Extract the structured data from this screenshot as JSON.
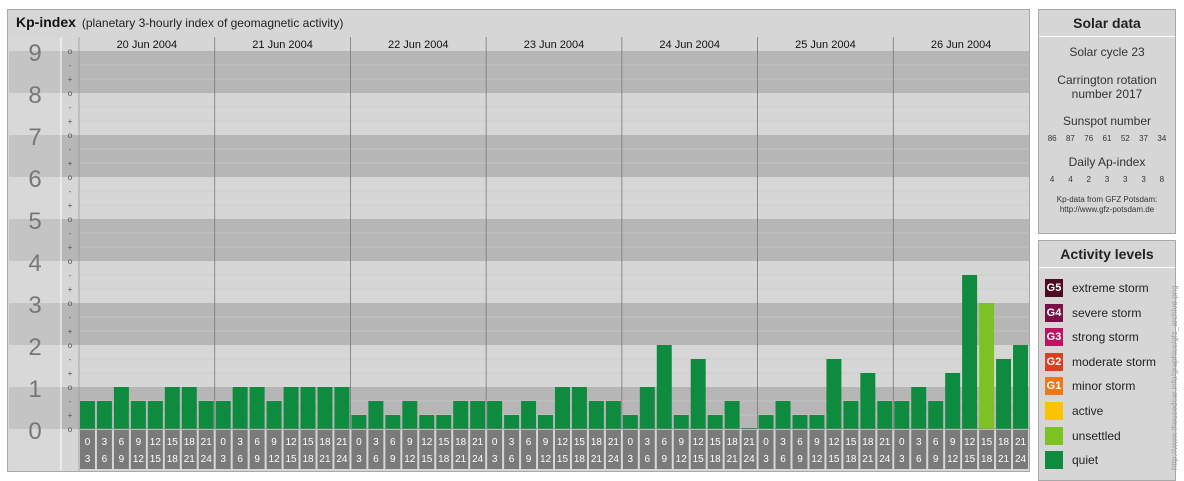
{
  "title": {
    "main": "Kp-index",
    "subtitle": "(planetary 3-hourly index of geomagnetic activity)"
  },
  "chart_data": {
    "type": "bar",
    "title": "Kp-index",
    "subtitle": "(planetary 3-hourly index of geomagnetic activity)",
    "ylim": [
      0,
      9
    ],
    "y_major_labels": [
      "0",
      "1",
      "2",
      "3",
      "4",
      "5",
      "6",
      "7",
      "8",
      "9"
    ],
    "y_minor_labels": [
      "o",
      "+",
      "-"
    ],
    "days": [
      "20 Jun 2004",
      "21 Jun 2004",
      "22 Jun 2004",
      "23 Jun 2004",
      "24 Jun 2004",
      "25 Jun 2004",
      "26 Jun 2004"
    ],
    "interval_start_labels": [
      "0",
      "3",
      "6",
      "9",
      "12",
      "15",
      "18",
      "21"
    ],
    "interval_end_labels": [
      "3",
      "6",
      "9",
      "12",
      "15",
      "18",
      "21",
      "24"
    ],
    "values": [
      [
        0.667,
        0.667,
        1.0,
        0.667,
        0.667,
        1.0,
        1.0,
        0.667
      ],
      [
        0.667,
        1.0,
        1.0,
        0.667,
        1.0,
        1.0,
        1.0,
        1.0
      ],
      [
        0.333,
        0.667,
        0.333,
        0.667,
        0.333,
        0.333,
        0.667,
        0.667
      ],
      [
        0.667,
        0.333,
        0.667,
        0.333,
        1.0,
        1.0,
        0.667,
        0.667
      ],
      [
        0.333,
        1.0,
        2.0,
        0.333,
        1.667,
        0.333,
        0.667,
        0.0
      ],
      [
        0.333,
        0.667,
        0.333,
        0.333,
        1.667,
        0.667,
        1.333,
        0.667
      ],
      [
        0.667,
        1.0,
        0.667,
        1.333,
        3.667,
        3.0,
        1.667,
        2.0
      ]
    ],
    "color_rules": [
      {
        "min": 0,
        "max": 2.5,
        "level": "quiet"
      },
      {
        "min": 3.0,
        "max": 3.5,
        "level": "unsettled"
      },
      {
        "min": 4.0,
        "max": 4.5,
        "level": "active"
      }
    ],
    "grid": true,
    "legend": "right"
  },
  "colors": {
    "quiet": "#0e8b3f",
    "unsettled": "#7dc224",
    "active": "#f9c300",
    "band_dark": "#b6b6b6",
    "band_light": "#d6d6d6",
    "axis_label": "#777777",
    "label_cell": "#7a7a7a"
  },
  "solar": {
    "title": "Solar data",
    "cycle": "Solar cycle 23",
    "carrington_line1": "Carrington rotation",
    "carrington_line2": "number 2017",
    "sunspot_title": "Sunspot number",
    "sunspot_values": [
      "86",
      "87",
      "76",
      "61",
      "52",
      "37",
      "34"
    ],
    "ap_title": "Daily Ap-index",
    "ap_values": [
      "4",
      "4",
      "2",
      "3",
      "3",
      "3",
      "8"
    ],
    "source_line1": "Kp-data from GFZ Potsdam:",
    "source_line2": "http://www.gfz-potsdam.de"
  },
  "activity": {
    "title": "Activity levels",
    "items": [
      {
        "code": "G5",
        "label": "extreme storm",
        "color": "#4c0a23",
        "icon": "g5-level-icon"
      },
      {
        "code": "G4",
        "label": "severe storm",
        "color": "#7a0f45",
        "icon": "g4-level-icon"
      },
      {
        "code": "G3",
        "label": "strong storm",
        "color": "#bb1361",
        "icon": "g3-level-icon"
      },
      {
        "code": "G2",
        "label": "moderate storm",
        "color": "#dd3e20",
        "icon": "g2-level-icon"
      },
      {
        "code": "G1",
        "label": "minor storm",
        "color": "#ee7818",
        "icon": "g1-level-icon"
      },
      {
        "code": "",
        "label": "active",
        "color": "#f9c300",
        "icon": "active-level-swatch"
      },
      {
        "code": "",
        "label": "unsettled",
        "color": "#7dc224",
        "icon": "unsettled-level-swatch"
      },
      {
        "code": "",
        "label": "quiet",
        "color": "#0e8b3f",
        "icon": "quiet-level-swatch"
      }
    ]
  },
  "credit": "http://www.theusedcar.info/graphics/gfz_archive.png"
}
